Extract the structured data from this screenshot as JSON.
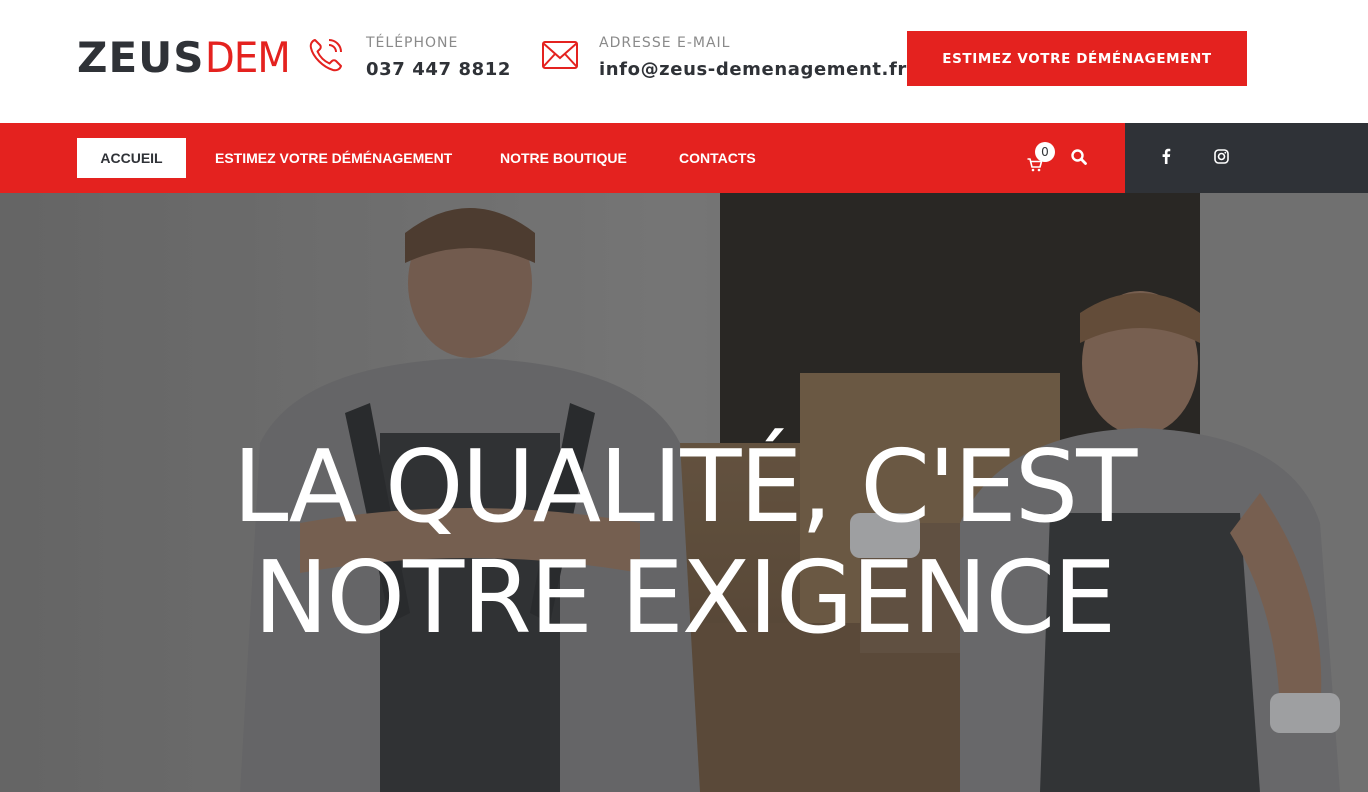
{
  "header": {
    "logo": {
      "part1": "ZEUS",
      "part2": "DEM"
    },
    "phone": {
      "label": "TÉLÉPHONE",
      "value": "037 447 8812",
      "icon": "phone-icon"
    },
    "email": {
      "label": "ADRESSE E-MAIL",
      "value": "info@zeus-demenagement.fr",
      "icon": "envelope-icon"
    },
    "cta_label": "ESTIMEZ VOTRE DÉMÉNAGEMENT"
  },
  "nav": {
    "items": [
      {
        "label": "ACCUEIL",
        "active": true
      },
      {
        "label": "ESTIMEZ VOTRE DÉMÉNAGEMENT",
        "active": false
      },
      {
        "label": "NOTRE BOUTIQUE",
        "active": false
      },
      {
        "label": "CONTACTS",
        "active": false
      }
    ],
    "cart_count": "0",
    "icons": [
      "cart-icon",
      "search-icon",
      "facebook-icon",
      "instagram-icon"
    ]
  },
  "hero": {
    "title_line1": "LA QUALITÉ, C'EST",
    "title_line2": "NOTRE EXIGENCE"
  },
  "colors": {
    "accent": "#e4221f",
    "dark": "#2f3237",
    "muted": "#8a8a8a"
  }
}
